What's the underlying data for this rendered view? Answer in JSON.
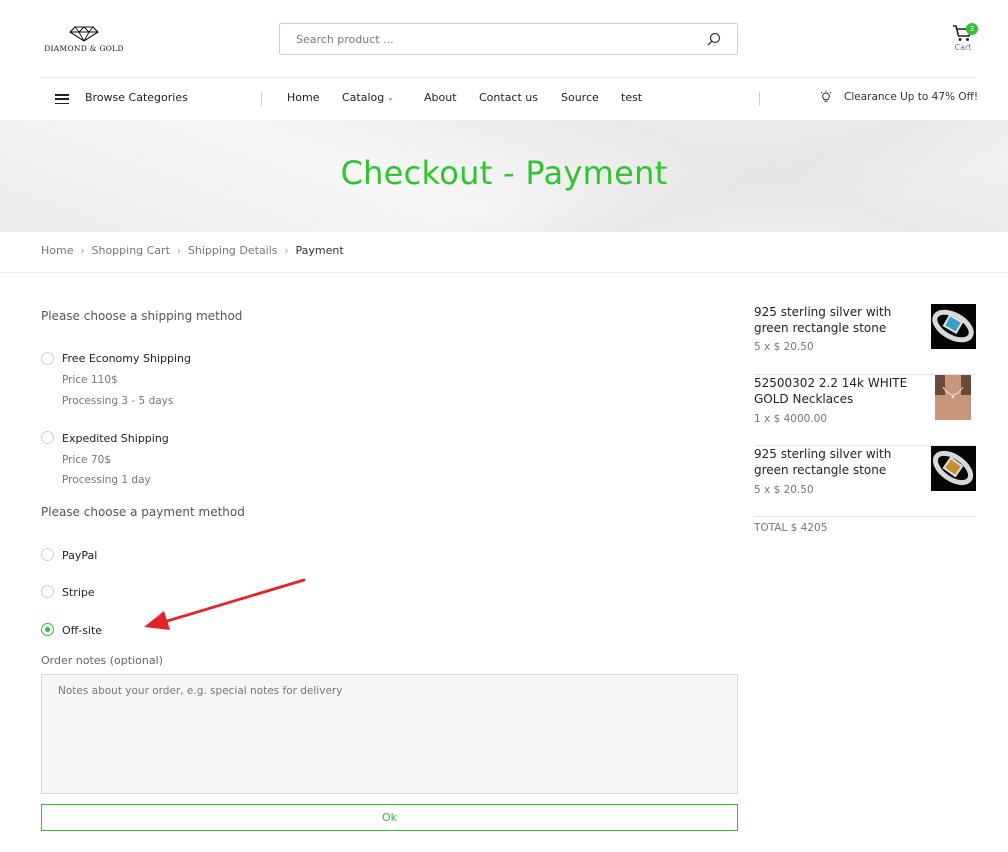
{
  "header": {
    "logo_text": "DIAMOND & GOLD",
    "search_placeholder": "Search product ...",
    "cart_count": "3",
    "cart_label": "Cart"
  },
  "nav": {
    "browse_label": "Browse Categories",
    "items": [
      "Home",
      "Catalog",
      "About",
      "Contact us",
      "Source",
      "test"
    ],
    "promo_text": "Clearance Up to 47% Off!"
  },
  "hero": {
    "title": "Checkout - Payment"
  },
  "breadcrumb": {
    "items": [
      "Home",
      "Shopping Cart",
      "Shipping Details",
      "Payment"
    ]
  },
  "shipping": {
    "title": "Please choose a shipping method",
    "options": [
      {
        "label": "Free Economy Shipping",
        "price": "Price 110$",
        "processing": "Processing 3 - 5 days"
      },
      {
        "label": "Expedited Shipping",
        "price": "Price 70$",
        "processing": "Processing 1 day"
      }
    ]
  },
  "payment": {
    "title": "Please choose a payment method",
    "options": [
      {
        "label": "PayPal",
        "checked": false
      },
      {
        "label": "Stripe",
        "checked": false
      },
      {
        "label": "Off-site",
        "checked": true
      }
    ]
  },
  "notes": {
    "label": "Order notes (optional)",
    "placeholder": "Notes about your order, e.g. special notes for delivery"
  },
  "ok_label": "Ok",
  "summary": {
    "items": [
      {
        "name": "925 sterling silver with green rectangle stone",
        "qty": "5 x $ 20.50"
      },
      {
        "name": "52500302 2.2 14k WHITE GOLD Necklaces",
        "qty": "1 x $ 4000.00"
      },
      {
        "name": "925 sterling silver with green rectangle stone",
        "qty": "5 x $ 20.50"
      }
    ],
    "total": "TOTAL $ 4205"
  },
  "colors": {
    "accent": "#2fc22f",
    "arrow": "#e0262a"
  }
}
